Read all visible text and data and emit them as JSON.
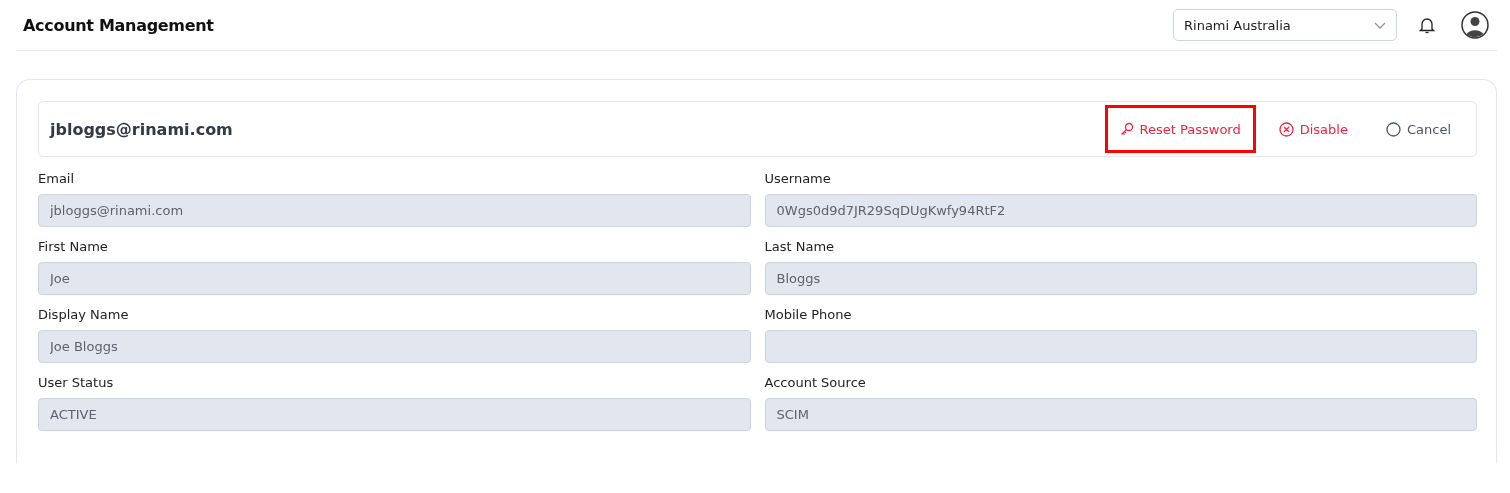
{
  "header": {
    "title": "Account Management",
    "organization_select": {
      "value": "Rinami Australia"
    }
  },
  "account": {
    "title": "jbloggs@rinami.com",
    "actions": [
      {
        "kind": "reset",
        "label": "Reset Password",
        "highlighted": true
      },
      {
        "kind": "disable",
        "label": "Disable",
        "highlighted": false
      },
      {
        "kind": "cancel",
        "label": "Cancel",
        "highlighted": false
      }
    ],
    "fields": [
      {
        "label": "Email",
        "value": "jbloggs@rinami.com"
      },
      {
        "label": "Username",
        "value": "0Wgs0d9d7JR29SqDUgKwfy94RtF2"
      },
      {
        "label": "First Name",
        "value": "Joe"
      },
      {
        "label": "Last Name",
        "value": "Bloggs"
      },
      {
        "label": "Display Name",
        "value": "Joe Bloggs"
      },
      {
        "label": "Mobile Phone"
      },
      {
        "label": "User Status",
        "value": "ACTIVE"
      },
      {
        "label": "Account Source",
        "value": "SCIM"
      }
    ]
  }
}
